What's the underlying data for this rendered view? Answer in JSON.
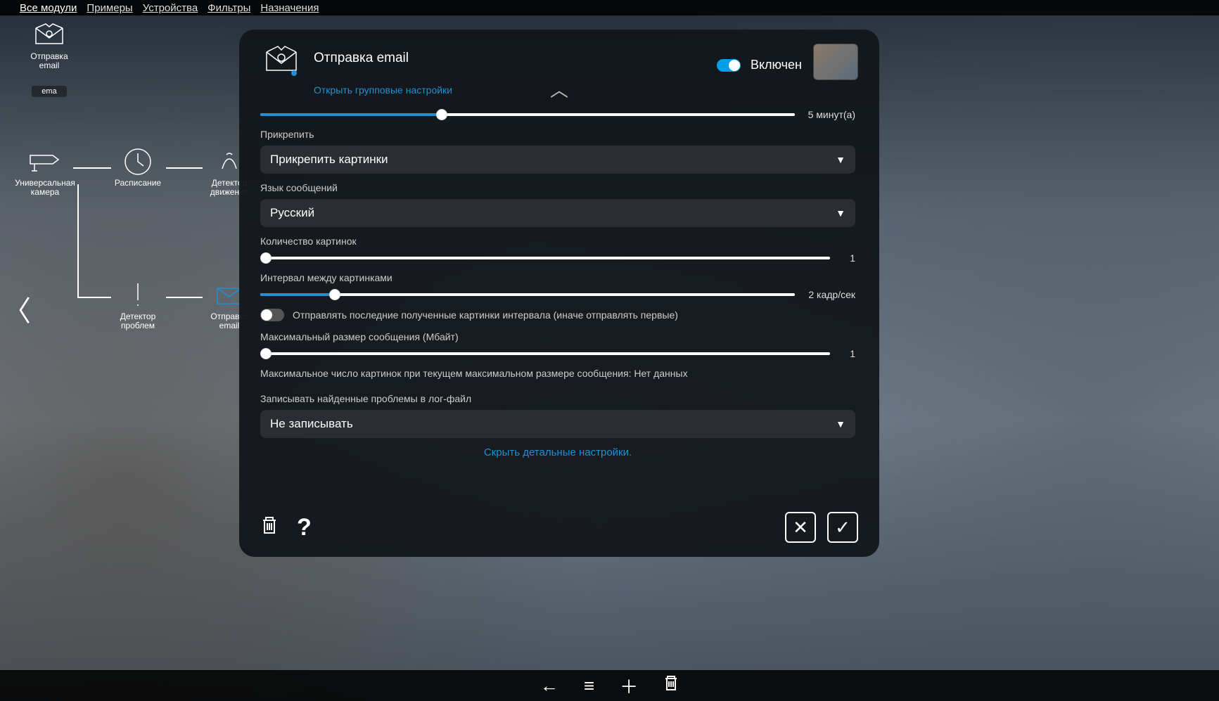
{
  "nav": {
    "items": [
      "Все модули",
      "Примеры",
      "Устройства",
      "Фильтры",
      "Назначения"
    ],
    "active_index": 0
  },
  "sidebar": {
    "email_node_label": "Отправка email",
    "email_input_value": "ema",
    "camera_label": "Универсальная камера",
    "schedule_label": "Расписание",
    "motion_label": "Детектор движения",
    "problem_label": "Детектор проблем",
    "sending_label": "Отправка email"
  },
  "modal": {
    "title": "Отправка email",
    "group_link": "Открыть групповые настройки",
    "enabled_label": "Включен",
    "sliders": {
      "duration": {
        "percent": 34,
        "text": "5 минут(а)"
      },
      "count": {
        "label": "Количество картинок",
        "percent": 1,
        "text": "1"
      },
      "interval": {
        "label": "Интервал между картинками",
        "percent": 14,
        "text": "2 кадр/сек"
      },
      "maxsize": {
        "label": "Максимальный размер сообщения (Мбайт)",
        "percent": 1,
        "text": "1"
      }
    },
    "attach": {
      "label": "Прикрепить",
      "value": "Прикрепить картинки"
    },
    "lang": {
      "label": "Язык сообщений",
      "value": "Русский"
    },
    "lastframes_toggle": {
      "text": "Отправлять последние полученные картинки интервала (иначе отправлять первые)"
    },
    "max_pics_info": "Максимальное число картинок при текущем максимальном размере сообщения: Нет данных",
    "log": {
      "label": "Записывать найденные проблемы в лог-файл",
      "value": "Не записывать"
    },
    "hide_detail": "Скрыть детальные настройки."
  },
  "bottombar": {
    "icons": [
      "back",
      "menu",
      "add",
      "delete"
    ]
  }
}
